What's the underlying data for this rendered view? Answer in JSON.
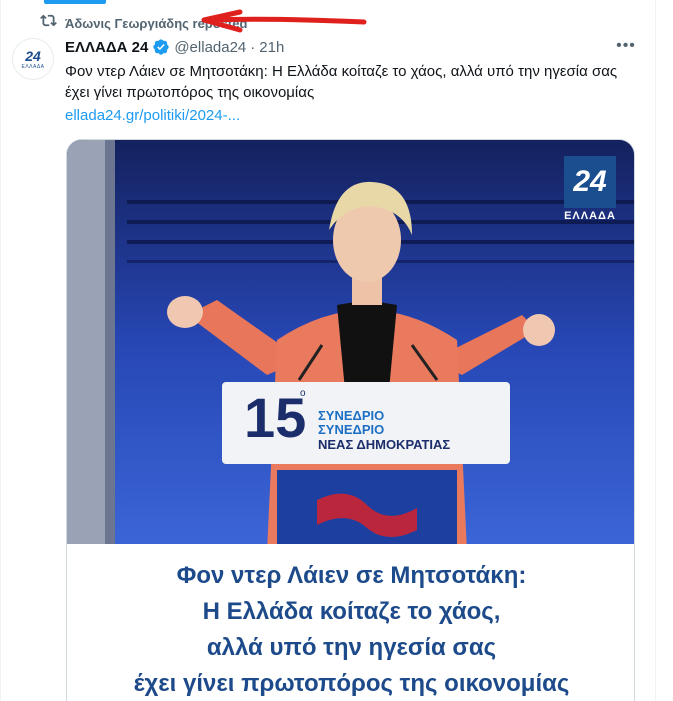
{
  "repost": {
    "icon": "repost-icon",
    "text": "Άδωνις Γεωργιάδης reposted"
  },
  "author": {
    "avatar_text": "24",
    "avatar_subtext": "ΕΛΛΑΔΑ",
    "name": "ΕΛΛΑΔΑ 24",
    "verified": true,
    "handle": "@ellada24",
    "separator": "·",
    "time": "21h"
  },
  "more_label": "•••",
  "tweet": {
    "text": "Φον ντερ Λάιεν σε Μητσοτάκη: Η Ελλάδα κοίταζε το χάος, αλλά υπό την ηγεσία σας έχει γίνει πρωτοπόρος της οικονομίας",
    "link": "ellada24.gr/politiki/2024-..."
  },
  "media": {
    "logo_number": "24",
    "logo_label": "ΕΛΛΑΔΑ",
    "podium": {
      "number": "15",
      "superscript": "ο",
      "line1": "ΣΥΝΕΔΡΙΟ",
      "line2": "ΣΥΝΕΔΡΙΟ",
      "line3": "ΝΕΑΣ ΔΗΜΟΚΡΑΤΙΑΣ"
    },
    "caption_lines": [
      "Φον ντερ Λάιεν σε Μητσοτάκη:",
      "Η Ελλάδα κοίταζε το χάος,",
      "αλλά υπό την ηγεσία σας",
      "έχει γίνει πρωτοπόρος της οικονομίας"
    ]
  },
  "colors": {
    "accent": "#1d9bf0",
    "annotation_arrow": "#e0201c",
    "caption_text": "#1d4a8a",
    "photo_background": "#1f3fa3"
  }
}
